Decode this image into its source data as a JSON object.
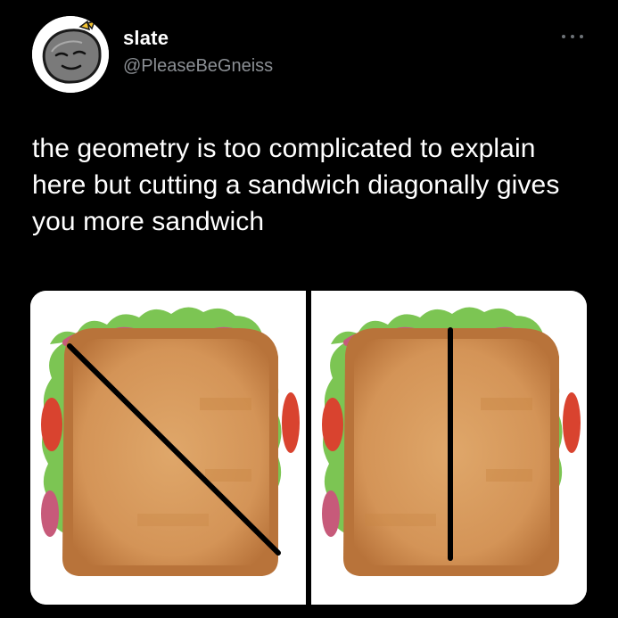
{
  "author": {
    "display_name": "slate",
    "handle": "@PleaseBeGneiss"
  },
  "tweet": {
    "text": "the geometry is too complicated to explain here but cutting a sandwich diagonally gives you more sandwich"
  },
  "icons": {
    "more": "more-options-icon"
  },
  "media": {
    "images": [
      {
        "name": "sandwich-cut-diagonally"
      },
      {
        "name": "sandwich-cut-vertically"
      }
    ]
  },
  "colors": {
    "background": "#000000",
    "text": "#ffffff",
    "handle": "#8b8f94",
    "bread": "#d9a165",
    "crust": "#b8733a",
    "lettuce": "#7cc553",
    "tomato": "#d9432f",
    "cut_line": "#000000"
  }
}
